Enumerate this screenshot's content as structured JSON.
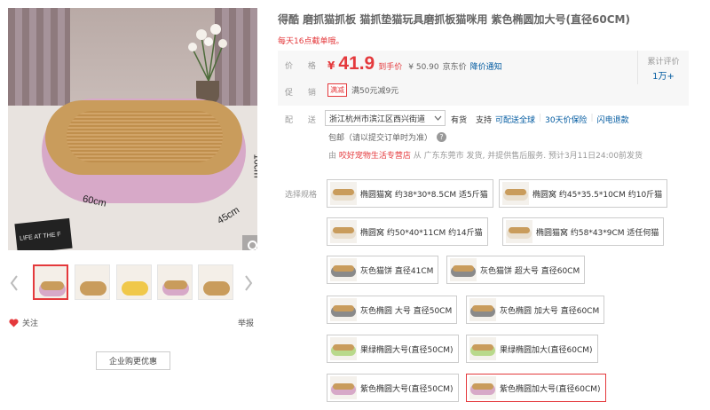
{
  "product": {
    "title": "得酷 磨抓猫抓板 猫抓垫猫玩具磨抓板猫咪用 紫色椭圆加大号(直径60CM)",
    "notice": "每天16点截单哦。"
  },
  "gallery": {
    "dimensions": {
      "length": "60cm",
      "width": "45cm",
      "height": "10cm"
    },
    "book_text": "LIFE AT THE F",
    "thumbnail_count": 5,
    "follow_label": "关注",
    "report_label": "举报",
    "enterprise_button": "企业购更优惠"
  },
  "price": {
    "label": "价 格",
    "currency": "¥",
    "value": "41.9",
    "tag": "到手价",
    "jd_price": "¥ 50.90",
    "jd_label": "京东价",
    "notify_link": "降价通知",
    "promo_label": "促 销",
    "promo_tag": "满减",
    "promo_text": "满50元减9元",
    "review_label": "累计评价",
    "review_count": "1万+"
  },
  "shipping": {
    "label": "配 送 至",
    "address": "浙江杭州市滨江区西兴街道",
    "in_stock": "有货",
    "support": "支持",
    "global": "可配送全球",
    "insurance": "30天价保险",
    "return": "闪电退款",
    "free_shipping": "包邮（请以提交订单时为准）",
    "seller_prefix": "由",
    "store_name": "咬好宠物生活专营店",
    "seller_suffix": "从 广东东莞市 发货, 并提供售后服务. 预计3月11日24:00前发货"
  },
  "specs": {
    "label": "选择规格",
    "options": [
      {
        "label": "椭圆猫窝 约38*30*8.5CM 适5斤猫",
        "color": "#c99c5c"
      },
      {
        "label": "椭圆窝 约45*35.5*10CM 约10斤猫",
        "color": "#c99c5c"
      },
      {
        "label": "椭圆窝 约50*40*11CM 约14斤猫",
        "color": "#c99c5c"
      },
      {
        "label": "椭圆猫窝 约58*43*9CM 适任何猫",
        "color": "#c99c5c"
      },
      {
        "label": "灰色猫饼 直径41CM",
        "color": "#8a8a8a"
      },
      {
        "label": "灰色猫饼 超大号 直径60CM",
        "color": "#8a8a8a"
      },
      {
        "label": "灰色椭圆 大号 直径50CM",
        "color": "#8a8a8a"
      },
      {
        "label": "灰色椭圆 加大号 直径60CM",
        "color": "#8a8a8a"
      },
      {
        "label": "果绿椭圆大号(直径50CM)",
        "color": "#b9d98b"
      },
      {
        "label": "果绿椭圆加大(直径60CM)",
        "color": "#b9d98b"
      },
      {
        "label": "紫色椭圆大号(直径50CM)",
        "color": "#d7a9c8"
      },
      {
        "label": "紫色椭圆加大号(直径60CM)",
        "color": "#d7a9c8",
        "selected": true
      }
    ]
  },
  "colors": {
    "accent": "#e4393c",
    "link": "#005aa0"
  }
}
